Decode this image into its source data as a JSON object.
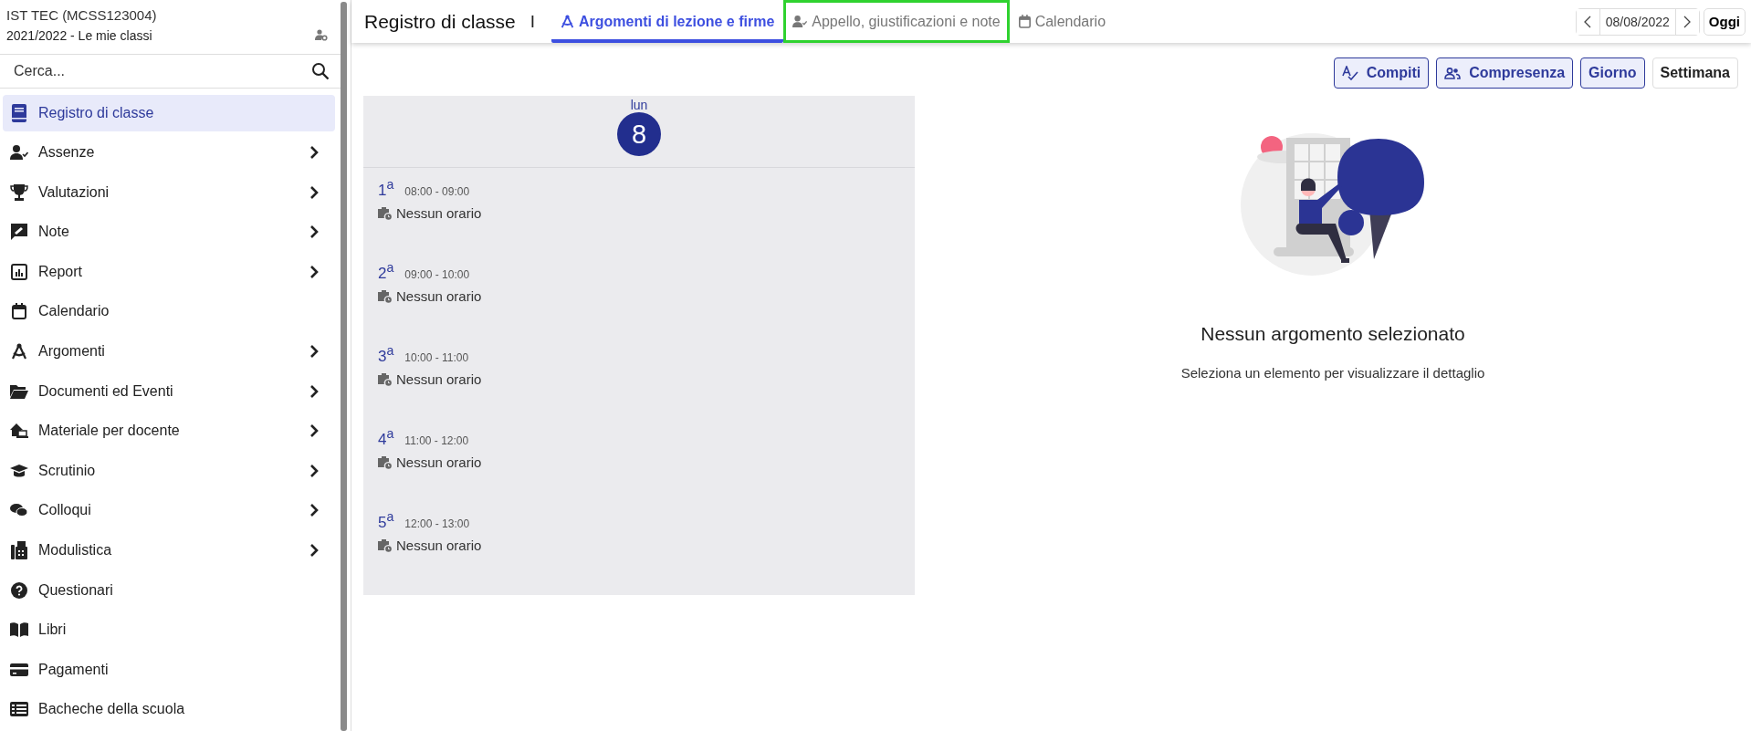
{
  "header": {
    "school": "IST TEC (MCSS123004)",
    "year": "2021/2022 - Le mie classi"
  },
  "search": {
    "placeholder": "Cerca..."
  },
  "sidebar": {
    "items": [
      {
        "label": "Registro di classe",
        "kind": "book",
        "expandable": false,
        "selected": true
      },
      {
        "label": "Assenze",
        "kind": "user-check",
        "expandable": true,
        "selected": false
      },
      {
        "label": "Valutazioni",
        "kind": "trophy",
        "expandable": true,
        "selected": false
      },
      {
        "label": "Note",
        "kind": "note",
        "expandable": true,
        "selected": false
      },
      {
        "label": "Report",
        "kind": "chart",
        "expandable": true,
        "selected": false
      },
      {
        "label": "Calendario",
        "kind": "calendar",
        "expandable": false,
        "selected": false
      },
      {
        "label": "Argomenti",
        "kind": "compass",
        "expandable": true,
        "selected": false
      },
      {
        "label": "Documenti ed Eventi",
        "kind": "folder",
        "expandable": true,
        "selected": false
      },
      {
        "label": "Materiale per docente",
        "kind": "house",
        "expandable": true,
        "selected": false
      },
      {
        "label": "Scrutinio",
        "kind": "cap",
        "expandable": true,
        "selected": false
      },
      {
        "label": "Colloqui",
        "kind": "chat",
        "expandable": true,
        "selected": false
      },
      {
        "label": "Modulistica",
        "kind": "fax",
        "expandable": true,
        "selected": false
      },
      {
        "label": "Questionari",
        "kind": "question",
        "expandable": false,
        "selected": false
      },
      {
        "label": "Libri",
        "kind": "open-book",
        "expandable": false,
        "selected": false
      },
      {
        "label": "Pagamenti",
        "kind": "card",
        "expandable": false,
        "selected": false
      },
      {
        "label": "Bacheche della scuola",
        "kind": "list",
        "expandable": false,
        "selected": false
      }
    ]
  },
  "topbar": {
    "title": "Registro di classe",
    "separator": "I",
    "tabs": [
      {
        "label": "Argomenti di lezione e firme",
        "kind": "compass",
        "selected": true,
        "highlighted": false
      },
      {
        "label": "Appello, giustificazioni e note",
        "kind": "user-check",
        "selected": false,
        "highlighted": true
      },
      {
        "label": "Calendario",
        "kind": "calendar",
        "selected": false,
        "highlighted": false
      }
    ],
    "date": "08/08/2022",
    "today_button": "Oggi"
  },
  "toolbar": {
    "buttons": [
      {
        "label": "Compiti",
        "kind": "spellcheck",
        "selected": true
      },
      {
        "label": "Compresenza",
        "kind": "people",
        "selected": true
      },
      {
        "label": "Giorno",
        "kind": "text",
        "selected": true
      },
      {
        "label": "Settimana",
        "kind": "text",
        "selected": false
      }
    ]
  },
  "day": {
    "weekday": "lun",
    "number": "8",
    "periods": [
      {
        "ordinal": "1$^{a}$",
        "time": "08:00 - 09:00",
        "status": "Nessun orario"
      },
      {
        "ordinal": "2$^{a}$",
        "time": "09:00 - 10:00",
        "status": "Nessun orario"
      },
      {
        "ordinal": "3$^{a}$",
        "time": "10:00 - 11:00",
        "status": "Nessun orario"
      },
      {
        "ordinal": "4$^{a}$",
        "time": "11:00 - 12:00",
        "status": "Nessun orario"
      },
      {
        "ordinal": "5$^{a}$",
        "time": "12:00 - 13:00",
        "status": "Nessun orario"
      }
    ]
  },
  "empty_state": {
    "title": "Nessun argomento selezionato",
    "subtitle": "Seleziona un elemento per visualizzare il dettaglio"
  }
}
